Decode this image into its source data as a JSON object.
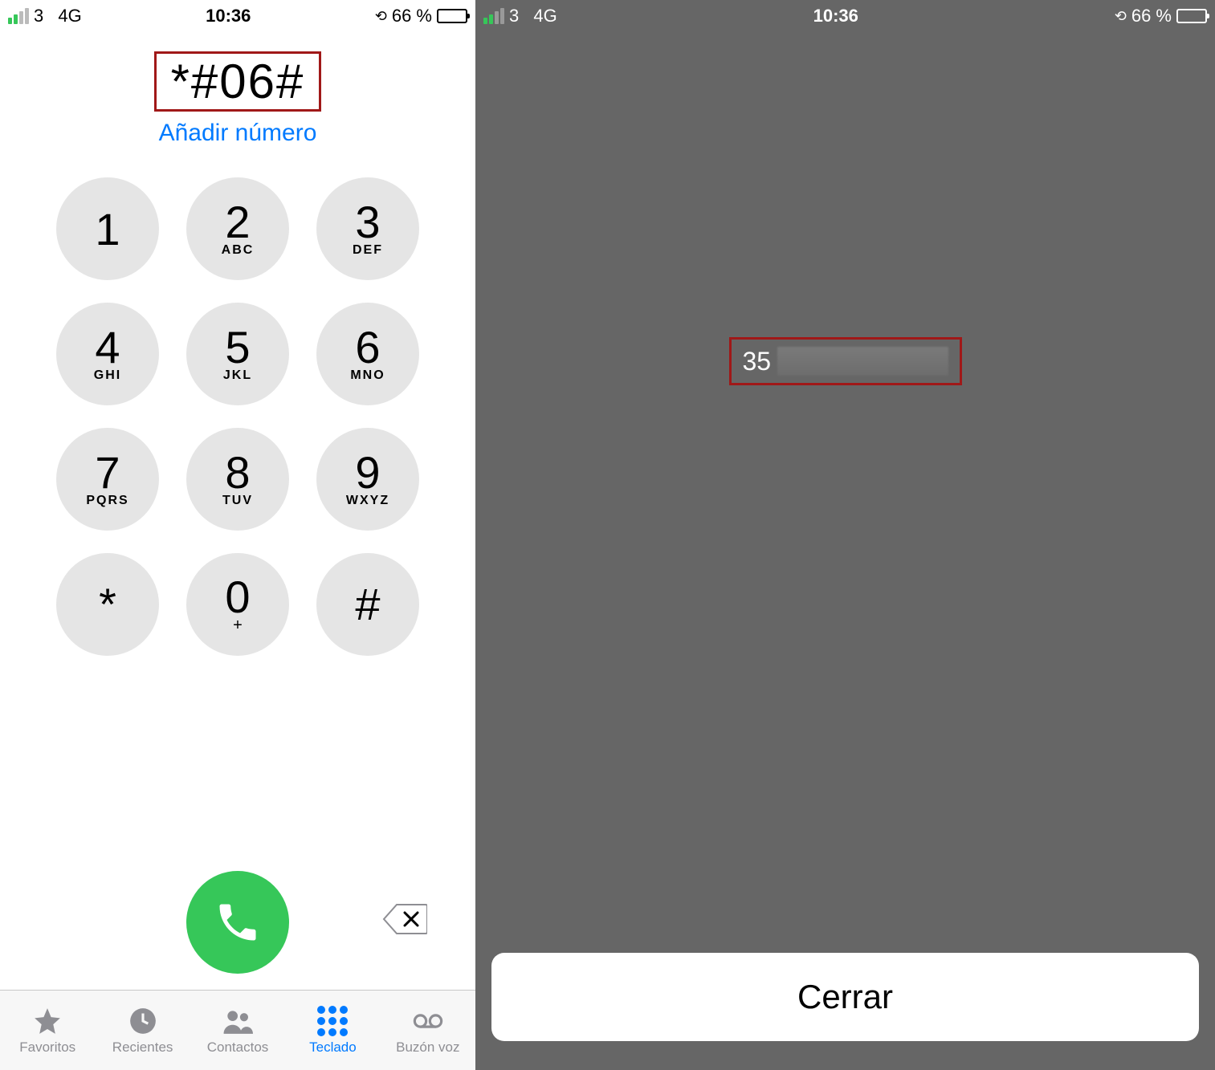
{
  "status": {
    "carrier_num": "3",
    "network": "4G",
    "time": "10:36",
    "battery_percent": "66 %"
  },
  "dialer": {
    "entered_number": "*#06#",
    "add_number_label": "Añadir número",
    "keys": [
      {
        "digit": "1",
        "letters": ""
      },
      {
        "digit": "2",
        "letters": "ABC"
      },
      {
        "digit": "3",
        "letters": "DEF"
      },
      {
        "digit": "4",
        "letters": "GHI"
      },
      {
        "digit": "5",
        "letters": "JKL"
      },
      {
        "digit": "6",
        "letters": "MNO"
      },
      {
        "digit": "7",
        "letters": "PQRS"
      },
      {
        "digit": "8",
        "letters": "TUV"
      },
      {
        "digit": "9",
        "letters": "WXYZ"
      },
      {
        "digit": "*",
        "letters": ""
      },
      {
        "digit": "0",
        "letters": "+"
      },
      {
        "digit": "#",
        "letters": ""
      }
    ]
  },
  "tabs": {
    "favorites": "Favoritos",
    "recents": "Recientes",
    "contacts": "Contactos",
    "keypad": "Teclado",
    "voicemail": "Buzón voz"
  },
  "result": {
    "imei_prefix": "35",
    "close_label": "Cerrar"
  }
}
